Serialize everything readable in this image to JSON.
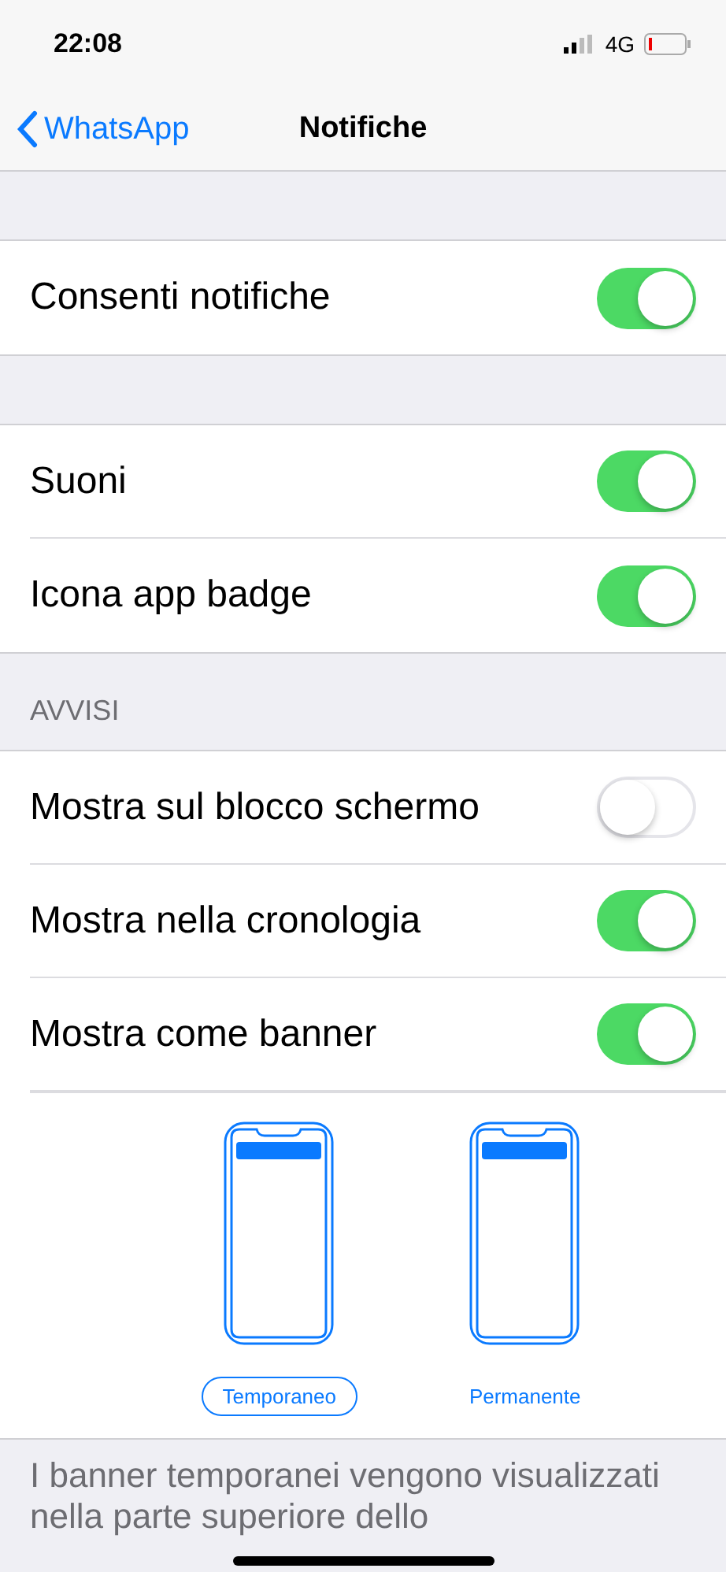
{
  "status_bar": {
    "time": "22:08",
    "network": "4G"
  },
  "nav": {
    "back": "WhatsApp",
    "title": "Notifiche"
  },
  "groups": [
    {
      "rows": [
        {
          "label": "Consenti notifiche",
          "on": true
        }
      ]
    },
    {
      "rows": [
        {
          "label": "Suoni",
          "on": true
        },
        {
          "label": "Icona app badge",
          "on": true
        }
      ]
    },
    {
      "header": "AVVISI",
      "rows": [
        {
          "label": "Mostra sul blocco schermo",
          "on": false
        },
        {
          "label": "Mostra nella cronologia",
          "on": true
        },
        {
          "label": "Mostra come banner",
          "on": true
        }
      ]
    }
  ],
  "banner_styles": [
    {
      "label": "Temporaneo",
      "selected": true
    },
    {
      "label": "Permanente",
      "selected": false
    }
  ],
  "footer": "I banner temporanei vengono visualizzati nella parte superiore dello"
}
